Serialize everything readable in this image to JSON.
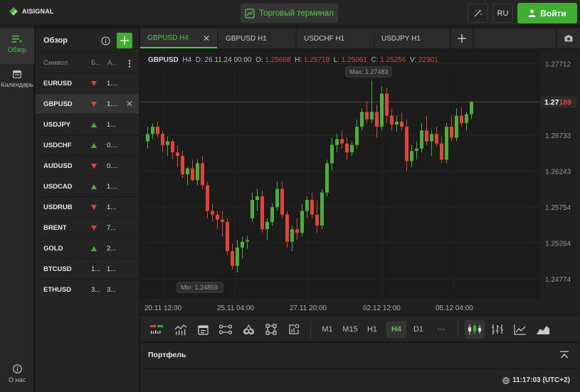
{
  "header": {
    "logo_text": "AISIGNAL",
    "terminal_label": "Торговый терминал",
    "lang": "RU",
    "login_label": "Войти"
  },
  "rail": {
    "items": [
      {
        "label": "Обзор",
        "icon": "list-icon"
      },
      {
        "label": "Календарь",
        "icon": "calendar-icon"
      },
      {
        "label": "О нас",
        "icon": "info-icon"
      }
    ]
  },
  "overview": {
    "title": "Обзор",
    "columns": {
      "symbol": "Символ",
      "bid": "Б...",
      "ask": "А..."
    },
    "rows": [
      {
        "symbol": "EURUSD",
        "dir": "down",
        "value": "1...."
      },
      {
        "symbol": "GBPUSD",
        "dir": "down",
        "value": "1...."
      },
      {
        "symbol": "USDJPY",
        "dir": "up",
        "value": "1..."
      },
      {
        "symbol": "USDCHF",
        "dir": "up",
        "value": "0...."
      },
      {
        "symbol": "AUDUSD",
        "dir": "down",
        "value": "0...."
      },
      {
        "symbol": "USDCAD",
        "dir": "up",
        "value": "1...."
      },
      {
        "symbol": "USDRUB",
        "dir": "down",
        "value": "1..."
      },
      {
        "symbol": "BRENT",
        "dir": "down",
        "value": "7..."
      },
      {
        "symbol": "GOLD",
        "dir": "up",
        "value": "2..."
      },
      {
        "symbol": "BTCUSD",
        "dir": "none",
        "value": "1...",
        "value2": "1..."
      },
      {
        "symbol": "ETHUSD",
        "dir": "none",
        "value": "3...",
        "value2": "3..."
      }
    ]
  },
  "tabs": [
    "GBPUSD H4",
    "GBPUSD H1",
    "USDCHF H1",
    "USDJPY H1"
  ],
  "chart": {
    "symbol": "GBPUSD",
    "timeframe": "H4",
    "d_label": "D:",
    "date": "26.11.24 00:00",
    "o_label": "O:",
    "open": "1.25668",
    "h_label": "H:",
    "high": "1.25719",
    "l_label": "L:",
    "low": "1.25061",
    "c_label": "C:",
    "close": "1.25256",
    "v_label": "V:",
    "volume": "22301",
    "max_label": "Max: 1.27483",
    "min_label": "Min: 1.24859",
    "price_prefix": "1.27",
    "price_suffix": "189",
    "price_levels": [
      "1.27712",
      "1.26733",
      "1.26243",
      "1.25754",
      "1.25264",
      "1.24774"
    ],
    "time_labels": [
      "20.11 12:00",
      "25.11 04:00",
      "27.11 20:00",
      "02.12 12:00",
      "05.12 04:00"
    ]
  },
  "chart_data": {
    "type": "candlestick",
    "x": [
      "20.11 12:00",
      "25.11 04:00",
      "27.11 20:00",
      "02.12 12:00",
      "05.12 04:00"
    ],
    "ylim": [
      1.245,
      1.279
    ],
    "up_color": "#4caf3a",
    "down_color": "#e0443c",
    "max": 1.27483,
    "min": 1.24859,
    "last_price": 1.27189,
    "candles": [
      {
        "o": 1.2665,
        "h": 1.2685,
        "l": 1.2655,
        "c": 1.2675
      },
      {
        "o": 1.2675,
        "h": 1.269,
        "l": 1.2668,
        "c": 1.2685
      },
      {
        "o": 1.2685,
        "h": 1.2692,
        "l": 1.267,
        "c": 1.2675
      },
      {
        "o": 1.2675,
        "h": 1.268,
        "l": 1.265,
        "c": 1.266
      },
      {
        "o": 1.266,
        "h": 1.2672,
        "l": 1.2645,
        "c": 1.2665
      },
      {
        "o": 1.2665,
        "h": 1.2668,
        "l": 1.264,
        "c": 1.265
      },
      {
        "o": 1.265,
        "h": 1.266,
        "l": 1.263,
        "c": 1.2645
      },
      {
        "o": 1.2645,
        "h": 1.2652,
        "l": 1.2615,
        "c": 1.262
      },
      {
        "o": 1.262,
        "h": 1.263,
        "l": 1.2605,
        "c": 1.2628
      },
      {
        "o": 1.2628,
        "h": 1.264,
        "l": 1.261,
        "c": 1.2612
      },
      {
        "o": 1.2612,
        "h": 1.264,
        "l": 1.2605,
        "c": 1.2635
      },
      {
        "o": 1.2635,
        "h": 1.2645,
        "l": 1.26,
        "c": 1.2605
      },
      {
        "o": 1.2605,
        "h": 1.261,
        "l": 1.256,
        "c": 1.257
      },
      {
        "o": 1.257,
        "h": 1.258,
        "l": 1.2555,
        "c": 1.2565
      },
      {
        "o": 1.2565,
        "h": 1.257,
        "l": 1.2545,
        "c": 1.2558
      },
      {
        "o": 1.2558,
        "h": 1.257,
        "l": 1.2535,
        "c": 1.2555
      },
      {
        "o": 1.2555,
        "h": 1.256,
        "l": 1.251,
        "c": 1.2515
      },
      {
        "o": 1.2515,
        "h": 1.2525,
        "l": 1.249,
        "c": 1.2495
      },
      {
        "o": 1.2495,
        "h": 1.253,
        "l": 1.2486,
        "c": 1.252
      },
      {
        "o": 1.252,
        "h": 1.2535,
        "l": 1.2505,
        "c": 1.2528
      },
      {
        "o": 1.2528,
        "h": 1.2536,
        "l": 1.2518,
        "c": 1.253
      },
      {
        "o": 1.256,
        "h": 1.2595,
        "l": 1.2555,
        "c": 1.2585
      },
      {
        "o": 1.2585,
        "h": 1.26,
        "l": 1.257,
        "c": 1.259
      },
      {
        "o": 1.259,
        "h": 1.2598,
        "l": 1.254,
        "c": 1.2545
      },
      {
        "o": 1.2545,
        "h": 1.256,
        "l": 1.253,
        "c": 1.2555
      },
      {
        "o": 1.2555,
        "h": 1.258,
        "l": 1.255,
        "c": 1.2575
      },
      {
        "o": 1.2575,
        "h": 1.261,
        "l": 1.257,
        "c": 1.26
      },
      {
        "o": 1.26,
        "h": 1.261,
        "l": 1.256,
        "c": 1.2565
      },
      {
        "o": 1.2565,
        "h": 1.257,
        "l": 1.252,
        "c": 1.2528
      },
      {
        "o": 1.2528,
        "h": 1.255,
        "l": 1.2515,
        "c": 1.2545
      },
      {
        "o": 1.2545,
        "h": 1.256,
        "l": 1.253,
        "c": 1.254
      },
      {
        "o": 1.254,
        "h": 1.258,
        "l": 1.2535,
        "c": 1.257
      },
      {
        "o": 1.257,
        "h": 1.259,
        "l": 1.256,
        "c": 1.2585
      },
      {
        "o": 1.2585,
        "h": 1.2595,
        "l": 1.256,
        "c": 1.2565
      },
      {
        "o": 1.2565,
        "h": 1.2585,
        "l": 1.254,
        "c": 1.255
      },
      {
        "o": 1.255,
        "h": 1.26,
        "l": 1.2545,
        "c": 1.2595
      },
      {
        "o": 1.2595,
        "h": 1.264,
        "l": 1.259,
        "c": 1.2635
      },
      {
        "o": 1.2635,
        "h": 1.267,
        "l": 1.2625,
        "c": 1.266
      },
      {
        "o": 1.266,
        "h": 1.2675,
        "l": 1.265,
        "c": 1.2668
      },
      {
        "o": 1.2668,
        "h": 1.268,
        "l": 1.2655,
        "c": 1.2662
      },
      {
        "o": 1.2662,
        "h": 1.267,
        "l": 1.264,
        "c": 1.265
      },
      {
        "o": 1.265,
        "h": 1.2665,
        "l": 1.2645,
        "c": 1.266
      },
      {
        "o": 1.266,
        "h": 1.2695,
        "l": 1.2655,
        "c": 1.2685
      },
      {
        "o": 1.2685,
        "h": 1.271,
        "l": 1.268,
        "c": 1.2705
      },
      {
        "o": 1.2705,
        "h": 1.272,
        "l": 1.269,
        "c": 1.2695
      },
      {
        "o": 1.2695,
        "h": 1.2748,
        "l": 1.269,
        "c": 1.2705
      },
      {
        "o": 1.2705,
        "h": 1.2715,
        "l": 1.267,
        "c": 1.2685
      },
      {
        "o": 1.2685,
        "h": 1.274,
        "l": 1.268,
        "c": 1.273
      },
      {
        "o": 1.273,
        "h": 1.2738,
        "l": 1.269,
        "c": 1.27
      },
      {
        "o": 1.27,
        "h": 1.271,
        "l": 1.268,
        "c": 1.2688
      },
      {
        "o": 1.2688,
        "h": 1.27,
        "l": 1.2678,
        "c": 1.2692
      },
      {
        "o": 1.2692,
        "h": 1.2705,
        "l": 1.268,
        "c": 1.2685
      },
      {
        "o": 1.2685,
        "h": 1.2695,
        "l": 1.2625,
        "c": 1.2638
      },
      {
        "o": 1.2638,
        "h": 1.266,
        "l": 1.263,
        "c": 1.2652
      },
      {
        "o": 1.2652,
        "h": 1.2665,
        "l": 1.264,
        "c": 1.2655
      },
      {
        "o": 1.2655,
        "h": 1.269,
        "l": 1.265,
        "c": 1.268
      },
      {
        "o": 1.268,
        "h": 1.27,
        "l": 1.266,
        "c": 1.2665
      },
      {
        "o": 1.2665,
        "h": 1.268,
        "l": 1.2645,
        "c": 1.2675
      },
      {
        "o": 1.2675,
        "h": 1.2685,
        "l": 1.2658,
        "c": 1.2662
      },
      {
        "o": 1.2662,
        "h": 1.2672,
        "l": 1.2635,
        "c": 1.264
      },
      {
        "o": 1.264,
        "h": 1.269,
        "l": 1.2635,
        "c": 1.2685
      },
      {
        "o": 1.2685,
        "h": 1.27,
        "l": 1.2665,
        "c": 1.267
      },
      {
        "o": 1.267,
        "h": 1.271,
        "l": 1.2665,
        "c": 1.27
      },
      {
        "o": 1.27,
        "h": 1.2712,
        "l": 1.2685,
        "c": 1.269
      },
      {
        "o": 1.269,
        "h": 1.2705,
        "l": 1.268,
        "c": 1.2702
      },
      {
        "o": 1.2702,
        "h": 1.272,
        "l": 1.2695,
        "c": 1.2719
      }
    ]
  },
  "timeframes": [
    "M1",
    "M15",
    "H1",
    "H4",
    "D1",
    "···"
  ],
  "active_timeframe": "H4",
  "portfolio": {
    "title": "Портфель",
    "time": "11:17:03 (UTC+2)"
  },
  "colors": {
    "accent": "#3fae30",
    "accent_text": "#58c64a",
    "down": "#e0443c",
    "up": "#4caf3a"
  }
}
